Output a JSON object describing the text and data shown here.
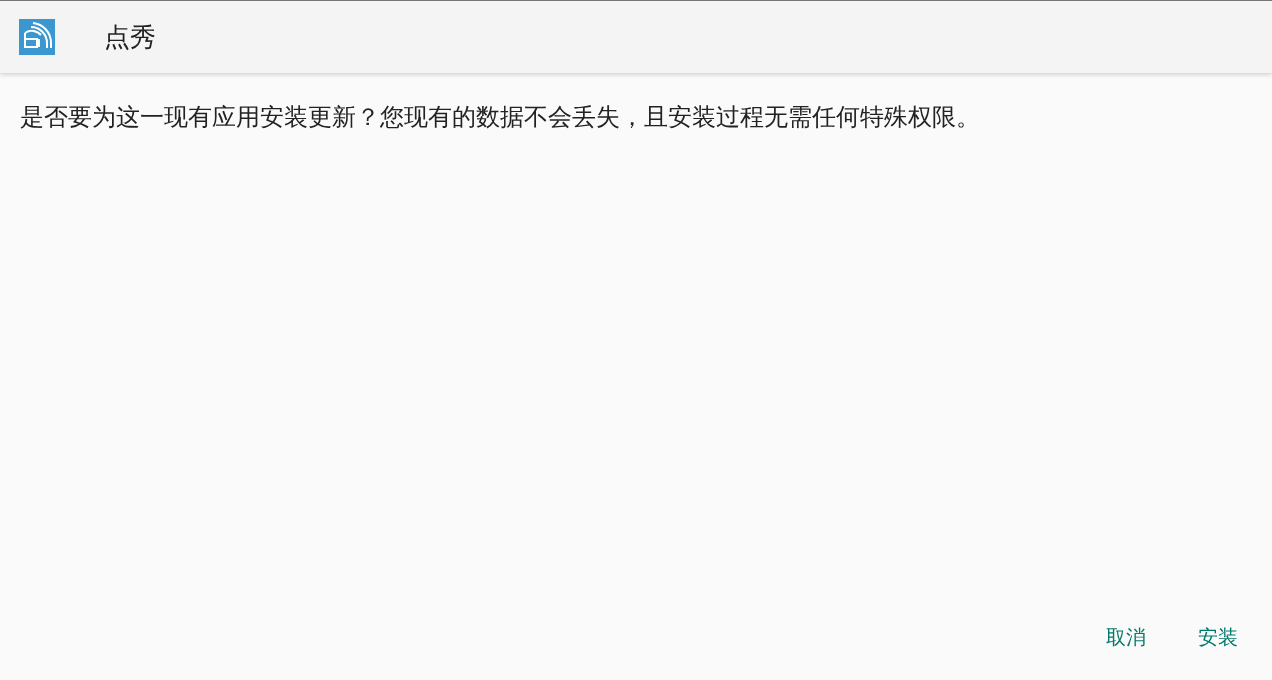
{
  "app": {
    "title": "点秀"
  },
  "message": "是否要为这一现有应用安装更新？您现有的数据不会丢失，且安装过程无需任何特殊权限。",
  "buttons": [
    {
      "label": "取消"
    },
    {
      "label": "安装"
    }
  ]
}
